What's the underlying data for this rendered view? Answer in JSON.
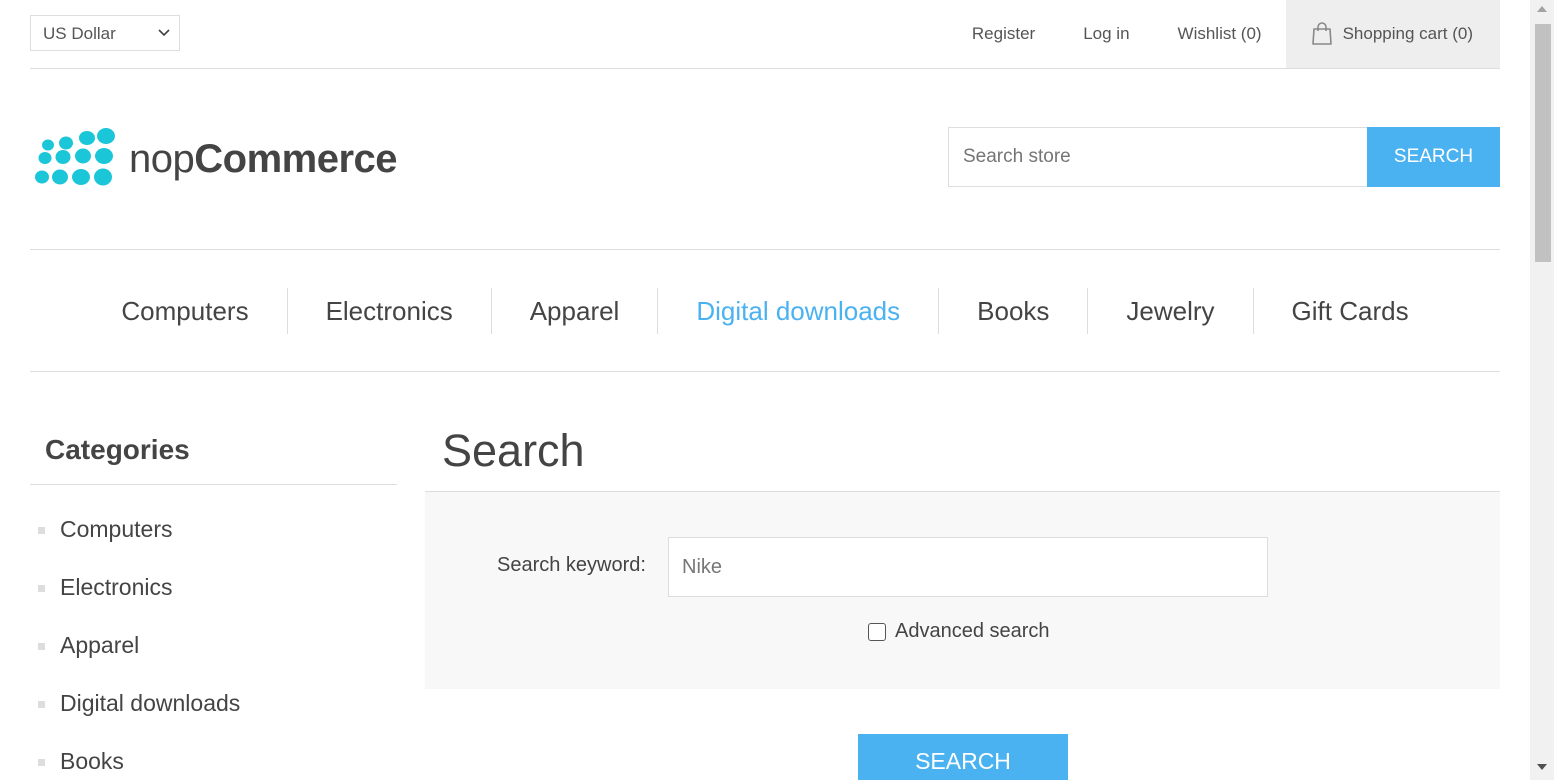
{
  "header": {
    "currency": "US Dollar",
    "links": [
      "Register",
      "Log in",
      "Wishlist (0)"
    ],
    "cart_label": "Shopping cart (0)"
  },
  "logo": {
    "text_light": "nop",
    "text_bold": "Commerce",
    "dot_color": "#1cc6d9"
  },
  "store_search": {
    "placeholder": "Search store",
    "button_label": "SEARCH"
  },
  "menu": {
    "items": [
      "Computers",
      "Electronics",
      "Apparel",
      "Digital downloads",
      "Books",
      "Jewelry",
      "Gift Cards"
    ],
    "active": "Digital downloads"
  },
  "sidebar": {
    "title": "Categories",
    "items": [
      "Computers",
      "Electronics",
      "Apparel",
      "Digital downloads",
      "Books"
    ]
  },
  "main": {
    "title": "Search",
    "keyword_label": "Search keyword:",
    "keyword_value": "Nike",
    "advanced_label": "Advanced search",
    "advanced_checked": false,
    "search_button": "SEARCH"
  },
  "colors": {
    "accent": "#4ab2f1",
    "text": "#444444",
    "border": "#dddddd"
  }
}
